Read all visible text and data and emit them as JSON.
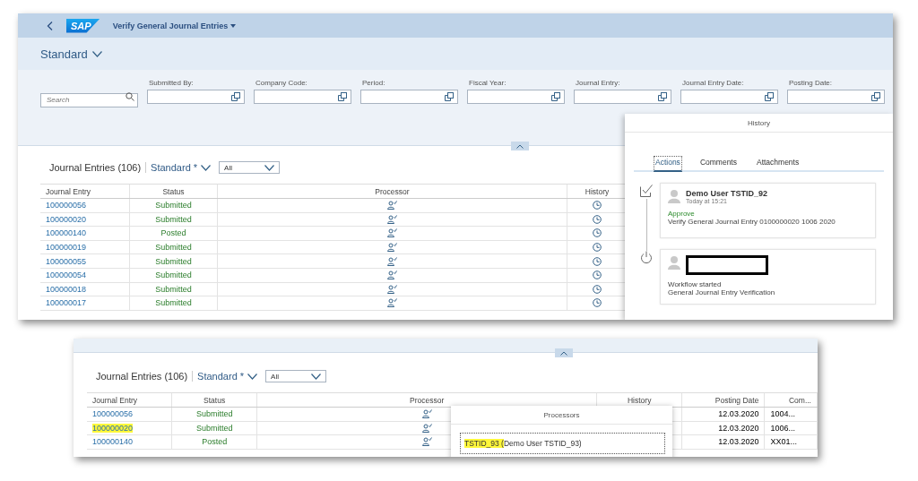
{
  "app": {
    "logo": "SAP",
    "title": "Verify General Journal Entries"
  },
  "variant": {
    "label": "Standard"
  },
  "filter_bar": {
    "search": {
      "placeholder": "Search"
    },
    "filters": [
      {
        "label": "Submitted By:"
      },
      {
        "label": "Company Code:"
      },
      {
        "label": "Period:"
      },
      {
        "label": "Fiscal Year:"
      },
      {
        "label": "Journal Entry:"
      },
      {
        "label": "Journal Entry Date:"
      },
      {
        "label": "Posting Date:"
      }
    ]
  },
  "table": {
    "title": "Journal Entries (106)",
    "variant": "Standard *",
    "filter_select": "All",
    "columns": [
      "Journal Entry",
      "Status",
      "Processor",
      "History"
    ],
    "rows": [
      {
        "journal_entry": "100000056",
        "status": "Submitted"
      },
      {
        "journal_entry": "100000020",
        "status": "Submitted"
      },
      {
        "journal_entry": "100000140",
        "status": "Posted"
      },
      {
        "journal_entry": "100000019",
        "status": "Submitted"
      },
      {
        "journal_entry": "100000055",
        "status": "Submitted"
      },
      {
        "journal_entry": "100000054",
        "status": "Submitted"
      },
      {
        "journal_entry": "100000018",
        "status": "Submitted"
      },
      {
        "journal_entry": "100000017",
        "status": "Submitted"
      }
    ]
  },
  "history_popover": {
    "title": "History",
    "tabs": [
      {
        "label": "Actions",
        "selected": true
      },
      {
        "label": "Comments",
        "selected": false
      },
      {
        "label": "Attachments",
        "selected": false
      }
    ],
    "entries": [
      {
        "kind": "approve",
        "user": "Demo User TSTID_92",
        "time": "Today at 15:21",
        "action": "Approve",
        "description": "Verify General Journal Entry 0100000020 1006 2020"
      },
      {
        "kind": "start",
        "action": "Workflow started",
        "description": "General Journal Entry Verification"
      }
    ]
  },
  "second_view": {
    "table": {
      "title": "Journal Entries (106)",
      "variant": "Standard *",
      "filter_select": "All",
      "columns": [
        "Journal Entry",
        "Status",
        "Processor",
        "History",
        "Posting Date",
        "Com..."
      ],
      "rows": [
        {
          "journal_entry": "100000056",
          "highlighted": false,
          "status": "Submitted",
          "posting_date": "12.03.2020",
          "column_6": "1004..."
        },
        {
          "journal_entry": "100000020",
          "highlighted": true,
          "status": "Submitted",
          "posting_date": "12.03.2020",
          "column_6": "1006..."
        },
        {
          "journal_entry": "100000140",
          "highlighted": false,
          "status": "Posted",
          "posting_date": "12.03.2020",
          "column_6": "XX01..."
        }
      ]
    },
    "processors_popover": {
      "title": "Processors",
      "items": [
        {
          "marked": "TSTID_93 (",
          "text": "Demo User TSTID_93)"
        }
      ]
    }
  }
}
